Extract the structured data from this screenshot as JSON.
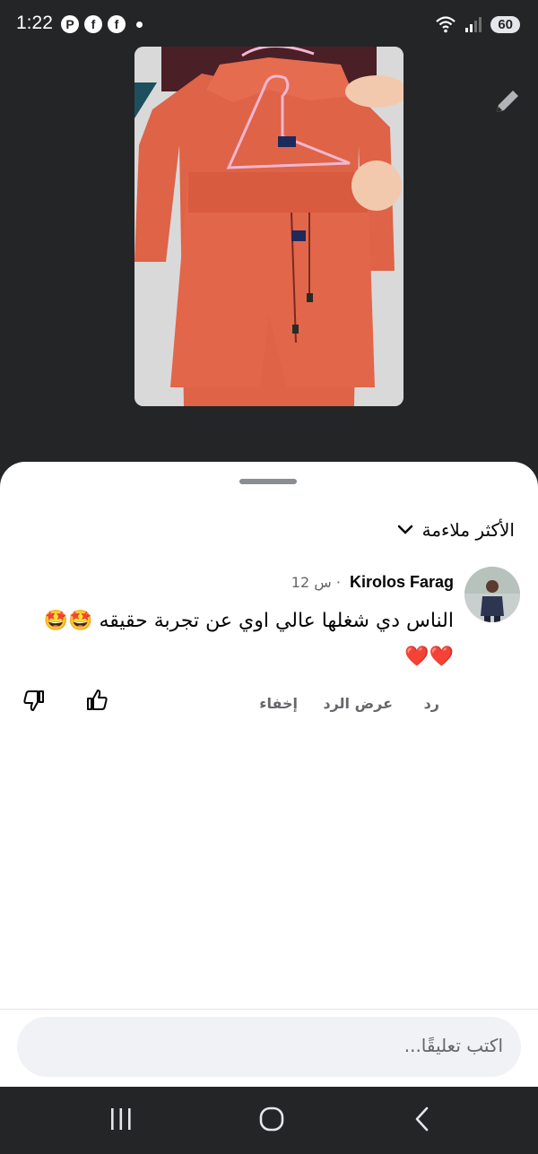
{
  "status_bar": {
    "time": "1:22",
    "left_icons": [
      "pinterest-icon",
      "facebook-icon",
      "facebook-icon",
      "notification-dot-icon"
    ],
    "right_icons": [
      "wifi-icon",
      "signal-icon"
    ],
    "battery": "60"
  },
  "comments_sheet": {
    "sort_label": "الأكثر ملاءمة",
    "comment": {
      "author": "Kirolos Farag",
      "time": "12 س",
      "separator": "·",
      "text": "الناس دي شغلها عالي اوي عن تجربة حقيقه 🤩🤩 ❤️❤️",
      "actions": {
        "reply": "رد",
        "view_replies": "عرض الرد",
        "hide": "إخفاء"
      }
    },
    "composer_placeholder": "اكتب تعليقًا..."
  },
  "colors": {
    "backdrop": "#242526",
    "sheet": "#ffffff",
    "product": "#e2664a",
    "secondary_text": "#65676b",
    "heart": "#e0161b"
  },
  "nav_bar": {
    "icons": [
      "recent-apps-icon",
      "home-icon",
      "back-icon"
    ]
  }
}
